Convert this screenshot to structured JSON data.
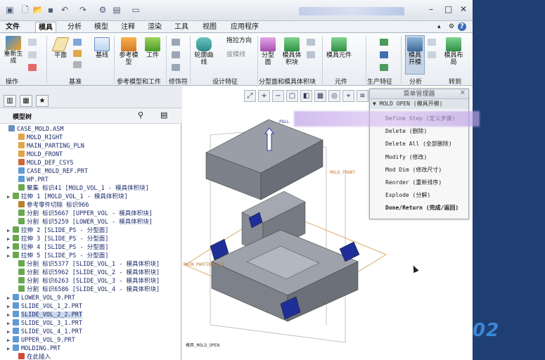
{
  "titlebar": {
    "window_controls": [
      "–",
      "□",
      "✕"
    ]
  },
  "menu": {
    "file": "文件",
    "tabs": [
      "模具",
      "分析",
      "模型",
      "注释",
      "渲染",
      "工具",
      "视图",
      "应用程序"
    ],
    "active_tab": "模具",
    "help": "?"
  },
  "ribbon": {
    "buttons": {
      "regenerate": "重新生成",
      "plane": "平面",
      "axis": "基线",
      "ref_model": "参考模型",
      "workpiece": "工件",
      "contour_curve": "轮廓曲线",
      "draft_dir": "拖拉方向",
      "draft_line": "拔模线",
      "parting_surface": "分型面",
      "mold_volume": "模具体积块",
      "mold_component": "模具元件",
      "mold_open": "模具开模",
      "mold_layout": "模具布局"
    },
    "groups": [
      "操作",
      "基准",
      "参考模型和工件",
      "修饰符",
      "设计特征",
      "分型面和模具体积块",
      "元件",
      "生产特征",
      "分析",
      "转到"
    ]
  },
  "tree": {
    "header": "模型树",
    "items": [
      {
        "label": "CASE_MOLD.ASM",
        "expand": ""
      },
      {
        "label": "MOLD_RIGHT",
        "expand": ""
      },
      {
        "label": "MAIN_PARTING_PLN",
        "expand": ""
      },
      {
        "label": "MOLD_FRONT",
        "expand": ""
      },
      {
        "label": "MOLD_DEF_CSYS",
        "expand": ""
      },
      {
        "label": "CASE_MOLD_REF.PRT",
        "expand": ""
      },
      {
        "label": "WP.PRT",
        "expand": ""
      },
      {
        "label": "聚集 标识41 [MOLD_VOL_1 - 模具体积块]",
        "expand": ""
      },
      {
        "label": "拉伸 1 [MOLD_VOL_1 - 模具体积块]",
        "expand": "▶"
      },
      {
        "label": "参考零件切除 标识966",
        "expand": ""
      },
      {
        "label": "分割 标识5667 [UPPER_VOL - 模具体积块]",
        "expand": ""
      },
      {
        "label": "分割 标识5259 [LOWER_VOL - 模具体积块]",
        "expand": ""
      },
      {
        "label": "拉伸 2 [SLIDE_PS - 分型面]",
        "expand": "▶"
      },
      {
        "label": "拉伸 3 [SLIDE_PS - 分型面]",
        "expand": "▶"
      },
      {
        "label": "拉伸 4 [SLIDE_PS - 分型面]",
        "expand": "▶"
      },
      {
        "label": "拉伸 5 [SLIDE_PS - 分型面]",
        "expand": "▶"
      },
      {
        "label": "分割 标识5377 [SLIDE_VOL_1 - 模具体积块]",
        "expand": ""
      },
      {
        "label": "分割 标识5962 [SLIDE_VOL_2 - 模具体积块]",
        "expand": ""
      },
      {
        "label": "分割 标识6263 [SLIDE_VOL_3 - 模具体积块]",
        "expand": ""
      },
      {
        "label": "分割 标识6586 [SLIDE_VOL_4 - 模具体积块]",
        "expand": ""
      },
      {
        "label": "LOWER_VOL_9.PRT",
        "expand": "▶"
      },
      {
        "label": "SLIDE_VOL_1_2.PRT",
        "expand": "▶"
      },
      {
        "label": "SLIDE_VOL_2_2.PRT",
        "expand": "▶"
      },
      {
        "label": "SLIDE_VOL_3_1.PRT",
        "expand": "▶"
      },
      {
        "label": "SLIDE_VOL_4_1.PRT",
        "expand": "▶"
      },
      {
        "label": "UPPER_VOL_9.PRT",
        "expand": "▶"
      },
      {
        "label": "MOLDING.PRT",
        "expand": "▶"
      },
      {
        "label": "在此插入",
        "expand": ""
      }
    ]
  },
  "viewport": {
    "labels": {
      "pull": "PULL",
      "mold_front": "MOLD_FRONT",
      "main_parting": "MAIN_PARTING_PLN",
      "model_label": "模具_MOLD_OPEN"
    }
  },
  "menu_manager": {
    "title": "菜单管理器",
    "submenu": "▼ MOLD OPEN (模具开模)",
    "items": [
      {
        "label": "Define Step (定义步骤)",
        "bold": false
      },
      {
        "label": "Delete (删除)",
        "bold": false
      },
      {
        "label": "Delete All (全部删除)",
        "bold": false
      },
      {
        "label": "Modify (修改)",
        "bold": false
      },
      {
        "label": "Mod Dim (修改尺寸)",
        "bold": false
      },
      {
        "label": "Reorder (重新排序)",
        "bold": false
      },
      {
        "label": "Explode (分解)",
        "bold": false
      },
      {
        "label": "Done/Return (完成/返回)",
        "bold": true
      }
    ]
  },
  "watermark": "02",
  "colors": {
    "accent": "#1f3f73",
    "tree_text": "#1a2a6a",
    "part_grey": "#9da3ad",
    "slide_blue": "#1e2f9a"
  }
}
